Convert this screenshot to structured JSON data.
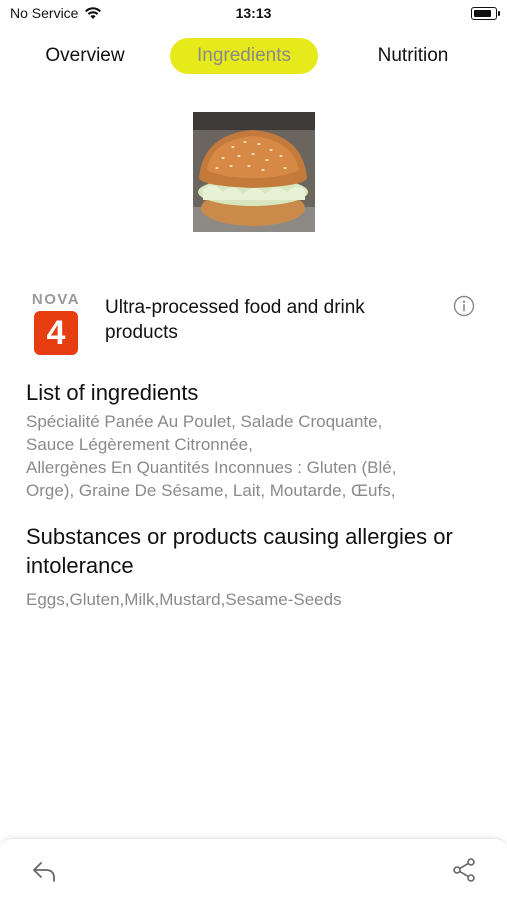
{
  "status_bar": {
    "carrier": "No Service",
    "time": "13:13",
    "battery_level": 0.85,
    "icons": [
      "wifi-icon",
      "battery-icon"
    ]
  },
  "tabs": [
    {
      "label": "Overview",
      "active": false
    },
    {
      "label": "Ingredients",
      "active": true
    },
    {
      "label": "Nutrition",
      "active": false
    }
  ],
  "colors": {
    "active_tab": "#e6ea1a",
    "nova_badge": "#e63e11"
  },
  "nova": {
    "label": "NOVA",
    "group": "4",
    "description": "Ultra-processed food and drink products",
    "info_icon": "info-icon"
  },
  "ingredients": {
    "title": "List of ingredients",
    "lines": [
      "Spécialité Panée Au Poulet, Salade Croquante,",
      "Sauce Légèrement Citronnée,",
      "Allergènes En Quantités Inconnues : Gluten (Blé,",
      "Orge), Graine De Sésame, Lait, Moutarde, Œufs,"
    ]
  },
  "allergens": {
    "title": "Substances or products causing allergies or intolerance",
    "text": "Eggs,Gluten,Milk,Mustard,Sesame-Seeds"
  },
  "bottom_bar": {
    "back_icon": "back-arrow-icon",
    "share_icon": "share-icon"
  }
}
